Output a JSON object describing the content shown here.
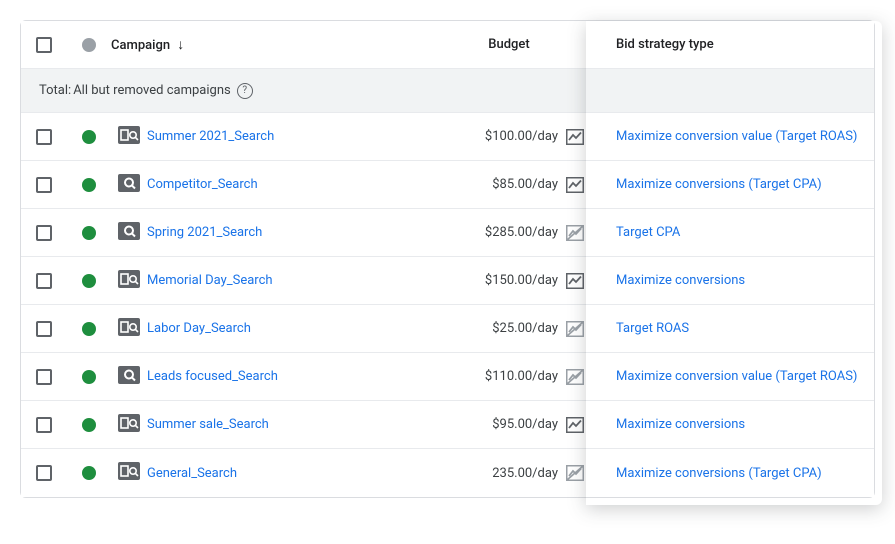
{
  "headers": {
    "campaign": "Campaign",
    "budget": "Budget",
    "bid_strategy": "Bid strategy type"
  },
  "total_row": {
    "prefix": "Total: ",
    "text": "All but removed campaigns"
  },
  "rows": [
    {
      "status": "green",
      "icon": "search-mag",
      "name": "Summer 2021_Search",
      "budget": "$100.00/day",
      "chart": "up",
      "bid": "Maximize conversion value (Target ROAS)"
    },
    {
      "status": "green",
      "icon": "search",
      "name": "Competitor_Search",
      "budget": "$85.00/day",
      "chart": "up",
      "bid": "Maximize conversions (Target CPA)"
    },
    {
      "status": "green",
      "icon": "search",
      "name": "Spring 2021_Search",
      "budget": "$285.00/day",
      "chart": "off",
      "bid": "Target CPA"
    },
    {
      "status": "green",
      "icon": "search-mag",
      "name": "Memorial Day_Search",
      "budget": "$150.00/day",
      "chart": "up",
      "bid": "Maximize conversions"
    },
    {
      "status": "green",
      "icon": "search-mag",
      "name": "Labor Day_Search",
      "budget": "$25.00/day",
      "chart": "off",
      "bid": "Target ROAS"
    },
    {
      "status": "green",
      "icon": "search",
      "name": "Leads focused_Search",
      "budget": "$110.00/day",
      "chart": "off",
      "bid": "Maximize conversion value (Target ROAS)"
    },
    {
      "status": "green",
      "icon": "search-mag",
      "name": "Summer sale_Search",
      "budget": "$95.00/day",
      "chart": "up",
      "bid": "Maximize conversions"
    },
    {
      "status": "green",
      "icon": "search-mag",
      "name": "General_Search",
      "budget": "235.00/day",
      "chart": "off",
      "bid": "Maximize conversions (Target CPA)"
    }
  ]
}
